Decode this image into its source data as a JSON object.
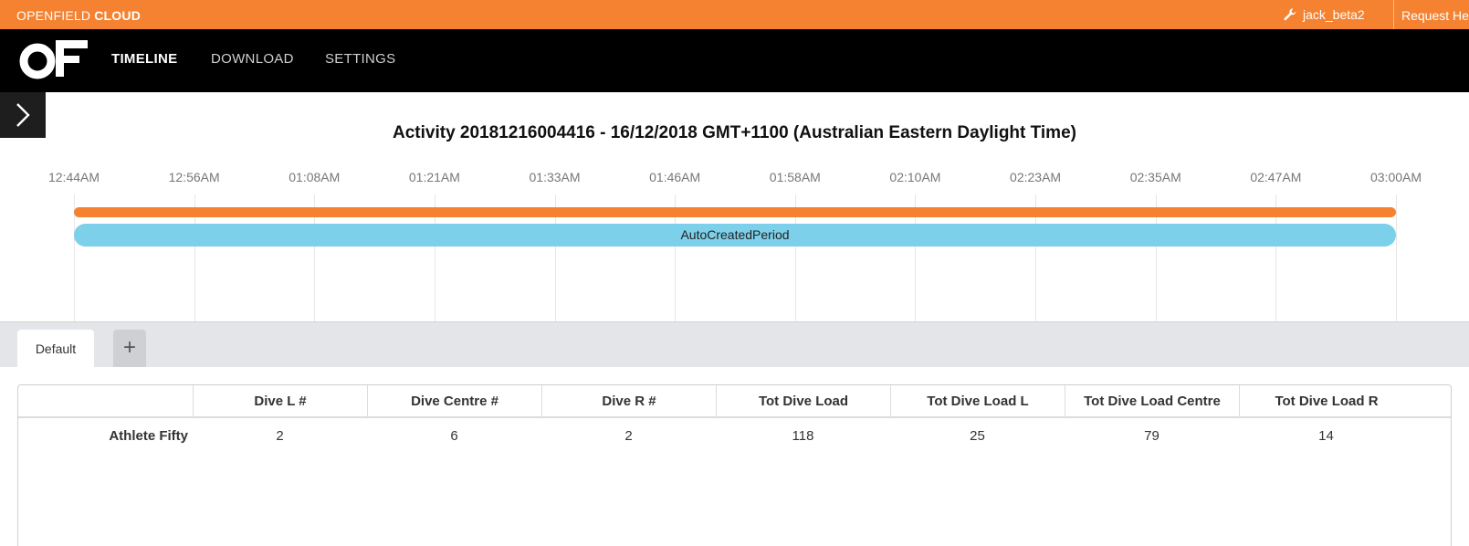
{
  "topbar": {
    "brand_part1": "OPENFIELD ",
    "brand_part2": "CLOUD",
    "username": "jack_beta2",
    "request_help": "Request He",
    "accent_color": "#f58231",
    "user_icon": "wrench-icon"
  },
  "nav": {
    "logo": "openfield-logo",
    "items": [
      {
        "label": "TIMELINE",
        "active": true
      },
      {
        "label": "DOWNLOAD",
        "active": false
      },
      {
        "label": "SETTINGS",
        "active": false
      }
    ]
  },
  "sidebar_toggle_icon": "chevron-right-icon",
  "timeline": {
    "title": "Activity 20181216004416 - 16/12/2018 GMT+1100 (Australian Eastern Daylight Time)",
    "ticks": [
      "12:44AM",
      "12:56AM",
      "01:08AM",
      "01:21AM",
      "01:33AM",
      "01:46AM",
      "01:58AM",
      "02:10AM",
      "02:23AM",
      "02:35AM",
      "02:47AM",
      "03:00AM"
    ],
    "activity_bar_color": "#f58231",
    "period_label": "AutoCreatedPeriod",
    "period_color": "#7dd0ea"
  },
  "tabs": {
    "items": [
      "Default"
    ],
    "add_label": "+"
  },
  "table": {
    "columns": [
      "",
      "Dive L #",
      "Dive Centre #",
      "Dive R #",
      "Tot Dive Load",
      "Tot Dive Load L",
      "Tot Dive Load Centre",
      "Tot Dive Load R"
    ],
    "rows": [
      {
        "athlete": "Athlete Fifty",
        "values": [
          "2",
          "6",
          "2",
          "118",
          "25",
          "79",
          "14"
        ]
      }
    ]
  }
}
